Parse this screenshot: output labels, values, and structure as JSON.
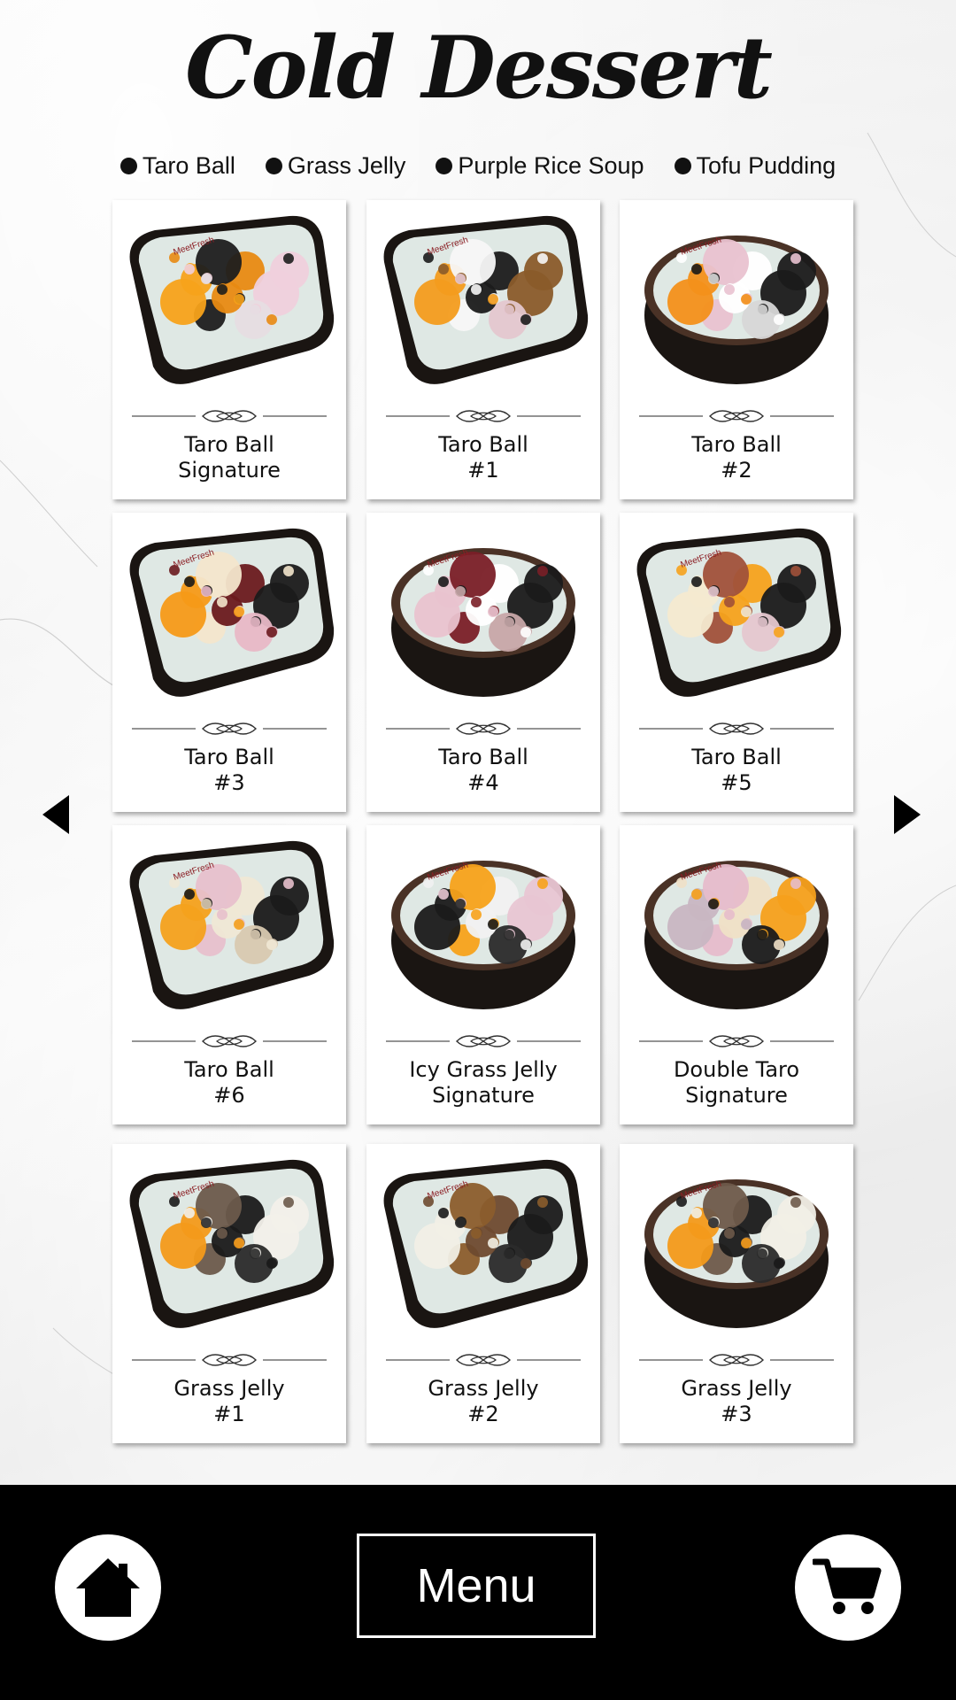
{
  "page": {
    "title": "Cold Dessert"
  },
  "categories": [
    {
      "label": "Taro Ball"
    },
    {
      "label": "Grass Jelly"
    },
    {
      "label": "Purple Rice Soup"
    },
    {
      "label": "Tofu Pudding"
    }
  ],
  "items": [
    {
      "line1": "Taro Ball",
      "line2": "Signature",
      "bowl": "square"
    },
    {
      "line1": "Taro Ball",
      "line2": "#1",
      "bowl": "square"
    },
    {
      "line1": "Taro Ball",
      "line2": "#2",
      "bowl": "round"
    },
    {
      "line1": "Taro Ball",
      "line2": "#3",
      "bowl": "square"
    },
    {
      "line1": "Taro Ball",
      "line2": "#4",
      "bowl": "round"
    },
    {
      "line1": "Taro Ball",
      "line2": "#5",
      "bowl": "square"
    },
    {
      "line1": "Taro Ball",
      "line2": "#6",
      "bowl": "square"
    },
    {
      "line1": "Icy Grass Jelly",
      "line2": "Signature",
      "bowl": "round"
    },
    {
      "line1": "Double Taro",
      "line2": "Signature",
      "bowl": "round"
    },
    {
      "line1": "Grass Jelly",
      "line2": "#1",
      "bowl": "square"
    },
    {
      "line1": "Grass Jelly",
      "line2": "#2",
      "bowl": "square"
    },
    {
      "line1": "Grass Jelly",
      "line2": "#3",
      "bowl": "round"
    }
  ],
  "nav": {
    "menu_label": "Menu",
    "home_icon": "home-icon",
    "cart_icon": "cart-icon",
    "prev_icon": "arrow-left-icon",
    "next_icon": "arrow-right-icon"
  },
  "colors": {
    "bar": "#000000",
    "text": "#111111",
    "card": "#ffffff"
  }
}
